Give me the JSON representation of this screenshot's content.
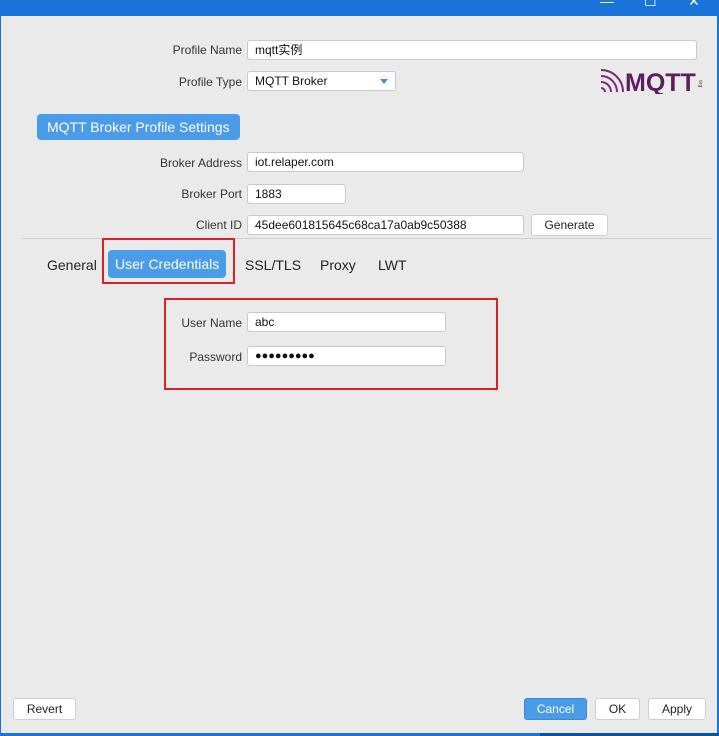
{
  "window": {
    "controls": {
      "minimize": "—",
      "maximize": "☐",
      "close": "✕"
    }
  },
  "profile": {
    "name_label": "Profile Name",
    "name_value": "mqtt实例",
    "type_label": "Profile Type",
    "type_value": "MQTT Broker"
  },
  "logo": {
    "text": "MQTT",
    "tag": "org",
    "icon": "mqtt-logo"
  },
  "section": {
    "title": "MQTT Broker Profile Settings"
  },
  "broker": {
    "address_label": "Broker Address",
    "address_value": "iot.relaper.com",
    "port_label": "Broker Port",
    "port_value": "1883",
    "client_label": "Client ID",
    "client_value": "45dee601815645c68ca17a0ab9c50388",
    "generate_label": "Generate"
  },
  "tabs": [
    {
      "label": "General",
      "active": false
    },
    {
      "label": "User Credentials",
      "active": true
    },
    {
      "label": "SSL/TLS",
      "active": false
    },
    {
      "label": "Proxy",
      "active": false
    },
    {
      "label": "LWT",
      "active": false
    }
  ],
  "credentials": {
    "username_label": "User Name",
    "username_value": "abc",
    "password_label": "Password",
    "password_value": "●●●●●●●●●"
  },
  "footer": {
    "revert": "Revert",
    "cancel": "Cancel",
    "ok": "OK",
    "apply": "Apply"
  },
  "colors": {
    "accent": "#4a9be8",
    "titlebar": "#1a73d9",
    "highlight": "#e02020",
    "background": "#eaeaea"
  }
}
